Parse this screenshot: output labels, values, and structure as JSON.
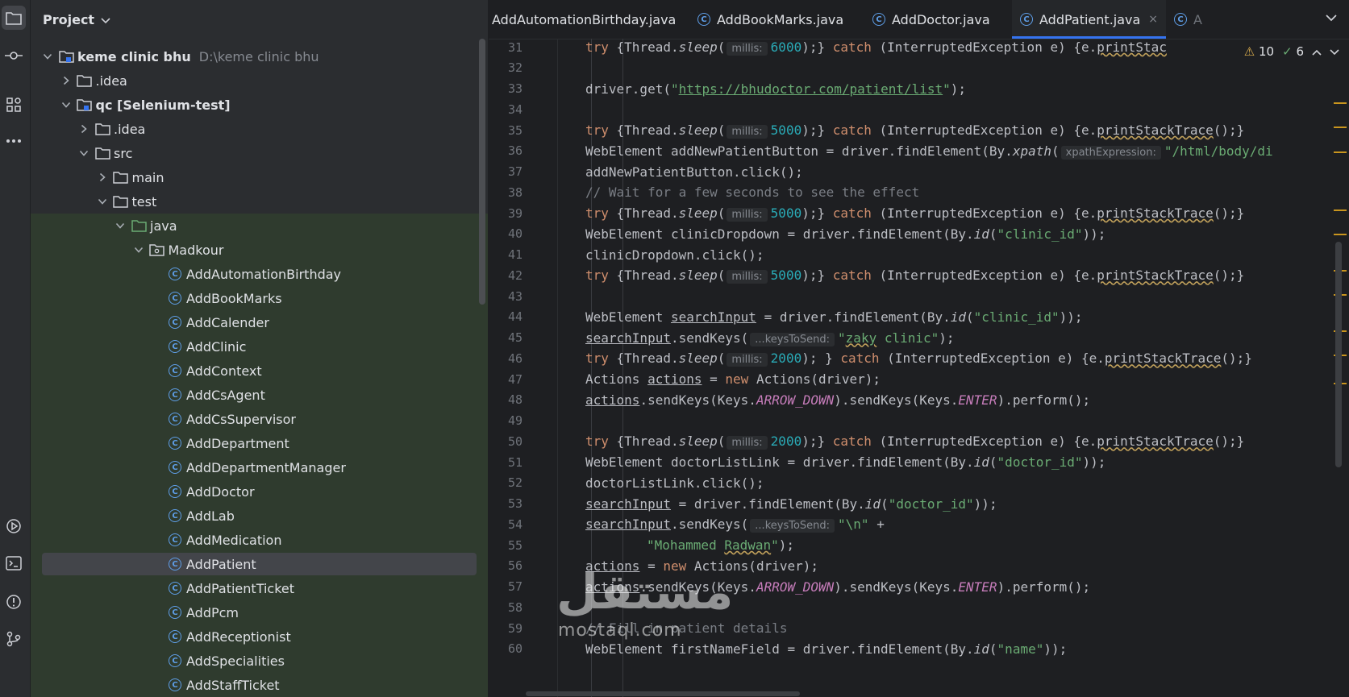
{
  "project_panel": {
    "title": "Project",
    "tree": [
      {
        "label": "keme clinic bhu",
        "path": "D:\\keme clinic bhu",
        "type": "module-folder",
        "depth": 0,
        "expanded": true
      },
      {
        "label": ".idea",
        "type": "folder",
        "depth": 1,
        "expanded": false
      },
      {
        "label": "qc [Selenium-test]",
        "type": "module-folder",
        "depth": 1,
        "expanded": true
      },
      {
        "label": ".idea",
        "type": "folder",
        "depth": 2,
        "expanded": false
      },
      {
        "label": "src",
        "type": "folder",
        "depth": 2,
        "expanded": true
      },
      {
        "label": "main",
        "type": "folder",
        "depth": 3,
        "expanded": false
      },
      {
        "label": "test",
        "type": "folder",
        "depth": 3,
        "expanded": true
      },
      {
        "label": "java",
        "type": "source-folder",
        "depth": 4,
        "expanded": true
      },
      {
        "label": "Madkour",
        "type": "package",
        "depth": 5,
        "expanded": true
      },
      {
        "label": "AddAutomationBirthday",
        "type": "class",
        "depth": 6
      },
      {
        "label": "AddBookMarks",
        "type": "class",
        "depth": 6
      },
      {
        "label": "AddCalender",
        "type": "class",
        "depth": 6
      },
      {
        "label": "AddClinic",
        "type": "class",
        "depth": 6
      },
      {
        "label": "AddContext",
        "type": "class",
        "depth": 6
      },
      {
        "label": "AddCsAgent",
        "type": "class",
        "depth": 6
      },
      {
        "label": "AddCsSupervisor",
        "type": "class",
        "depth": 6
      },
      {
        "label": "AddDepartment",
        "type": "class",
        "depth": 6
      },
      {
        "label": "AddDepartmentManager",
        "type": "class",
        "depth": 6
      },
      {
        "label": "AddDoctor",
        "type": "class",
        "depth": 6
      },
      {
        "label": "AddLab",
        "type": "class",
        "depth": 6
      },
      {
        "label": "AddMedication",
        "type": "class",
        "depth": 6
      },
      {
        "label": "AddPatient",
        "type": "class",
        "depth": 6,
        "selected": true
      },
      {
        "label": "AddPatientTicket",
        "type": "class",
        "depth": 6
      },
      {
        "label": "AddPcm",
        "type": "class",
        "depth": 6
      },
      {
        "label": "AddReceptionist",
        "type": "class",
        "depth": 6
      },
      {
        "label": "AddSpecialities",
        "type": "class",
        "depth": 6
      },
      {
        "label": "AddStaffTicket",
        "type": "class",
        "depth": 6
      }
    ]
  },
  "editor": {
    "tabs": [
      {
        "label": "AddAutomationBirthday.java",
        "active": false
      },
      {
        "label": "AddBookMarks.java",
        "active": false
      },
      {
        "label": "AddDoctor.java",
        "active": false
      },
      {
        "label": "AddPatient.java",
        "active": true
      },
      {
        "label": "A",
        "active": false
      }
    ],
    "tab_close": "×",
    "inspections": {
      "warnings": "10",
      "weak_warnings": "6"
    },
    "lines": [
      {
        "n": "31",
        "indent": 2,
        "tokens": [
          [
            "kw",
            "try "
          ],
          [
            "p",
            "{Thread."
          ],
          [
            "it",
            "sleep"
          ],
          [
            "p",
            "("
          ],
          [
            "hint",
            "millis:"
          ],
          [
            "num",
            "6000"
          ],
          [
            "p",
            ");} "
          ],
          [
            "kw",
            "catch "
          ],
          [
            "p",
            "(InterruptedException e) {e."
          ],
          [
            "wavy",
            "printStac"
          ]
        ]
      },
      {
        "n": "32",
        "indent": 0,
        "tokens": []
      },
      {
        "n": "33",
        "indent": 2,
        "tokens": [
          [
            "p",
            "driver.get("
          ],
          [
            "str",
            "\""
          ],
          [
            "url",
            "https://bhudoctor.com/patient/list"
          ],
          [
            "str",
            "\""
          ],
          [
            "p",
            ");"
          ]
        ]
      },
      {
        "n": "34",
        "indent": 0,
        "tokens": []
      },
      {
        "n": "35",
        "indent": 2,
        "tokens": [
          [
            "kw",
            "try "
          ],
          [
            "p",
            "{Thread."
          ],
          [
            "it",
            "sleep"
          ],
          [
            "p",
            "("
          ],
          [
            "hint",
            "millis:"
          ],
          [
            "num",
            "5000"
          ],
          [
            "p",
            ");} "
          ],
          [
            "kw",
            "catch "
          ],
          [
            "p",
            "(InterruptedException e) {e."
          ],
          [
            "wavy",
            "printStackTrace"
          ],
          [
            "p",
            "();}"
          ]
        ]
      },
      {
        "n": "36",
        "indent": 2,
        "tokens": [
          [
            "p",
            "WebElement addNewPatientButton = driver.findElement(By."
          ],
          [
            "it",
            "xpath"
          ],
          [
            "p",
            "("
          ],
          [
            "hint",
            "xpathExpression:"
          ],
          [
            "str",
            "\"/html/body/di"
          ]
        ]
      },
      {
        "n": "37",
        "indent": 2,
        "tokens": [
          [
            "p",
            "addNewPatientButton.click();"
          ]
        ]
      },
      {
        "n": "38",
        "indent": 2,
        "tokens": [
          [
            "cmt",
            "// Wait for a few seconds to see the effect"
          ]
        ]
      },
      {
        "n": "39",
        "indent": 2,
        "tokens": [
          [
            "kw",
            "try "
          ],
          [
            "p",
            "{Thread."
          ],
          [
            "it",
            "sleep"
          ],
          [
            "p",
            "("
          ],
          [
            "hint",
            "millis:"
          ],
          [
            "num",
            "5000"
          ],
          [
            "p",
            ");} "
          ],
          [
            "kw",
            "catch "
          ],
          [
            "p",
            "(InterruptedException e) {e."
          ],
          [
            "wavy",
            "printStackTrace"
          ],
          [
            "p",
            "();}"
          ]
        ]
      },
      {
        "n": "40",
        "indent": 2,
        "tokens": [
          [
            "p",
            "WebElement clinicDropdown = driver.findElement(By."
          ],
          [
            "it",
            "id"
          ],
          [
            "p",
            "("
          ],
          [
            "str",
            "\"clinic_id\""
          ],
          [
            "p",
            "));"
          ]
        ]
      },
      {
        "n": "41",
        "indent": 2,
        "tokens": [
          [
            "p",
            "clinicDropdown.click();"
          ]
        ]
      },
      {
        "n": "42",
        "indent": 2,
        "tokens": [
          [
            "kw",
            "try "
          ],
          [
            "p",
            "{Thread."
          ],
          [
            "it",
            "sleep"
          ],
          [
            "p",
            "("
          ],
          [
            "hint",
            "millis:"
          ],
          [
            "num",
            "5000"
          ],
          [
            "p",
            ");} "
          ],
          [
            "kw",
            "catch "
          ],
          [
            "p",
            "(InterruptedException e) {e."
          ],
          [
            "wavy",
            "printStackTrace"
          ],
          [
            "p",
            "();}"
          ]
        ]
      },
      {
        "n": "43",
        "indent": 0,
        "tokens": []
      },
      {
        "n": "44",
        "indent": 2,
        "tokens": [
          [
            "p",
            "WebElement "
          ],
          [
            "ul",
            "searchInput"
          ],
          [
            "p",
            " = driver.findElement(By."
          ],
          [
            "it",
            "id"
          ],
          [
            "p",
            "("
          ],
          [
            "str",
            "\"clinic_id\""
          ],
          [
            "p",
            "));"
          ]
        ]
      },
      {
        "n": "45",
        "indent": 2,
        "tokens": [
          [
            "ul",
            "searchInput"
          ],
          [
            "p",
            ".sendKeys("
          ],
          [
            "hint",
            "...keysToSend:"
          ],
          [
            "str",
            "\""
          ],
          [
            "strwavy",
            "zaky"
          ],
          [
            "str",
            " clinic\""
          ],
          [
            "p",
            ");"
          ]
        ]
      },
      {
        "n": "46",
        "indent": 2,
        "tokens": [
          [
            "kw",
            "try "
          ],
          [
            "p",
            "{Thread."
          ],
          [
            "it",
            "sleep"
          ],
          [
            "p",
            "("
          ],
          [
            "hint",
            "millis:"
          ],
          [
            "num",
            "2000"
          ],
          [
            "p",
            "); } "
          ],
          [
            "kw",
            "catch "
          ],
          [
            "p",
            "(InterruptedException e) {e."
          ],
          [
            "wavy",
            "printStackTrace"
          ],
          [
            "p",
            "();}"
          ]
        ]
      },
      {
        "n": "47",
        "indent": 2,
        "tokens": [
          [
            "p",
            "Actions "
          ],
          [
            "ul",
            "actions"
          ],
          [
            "p",
            " = "
          ],
          [
            "kw",
            "new "
          ],
          [
            "p",
            "Actions(driver);"
          ]
        ]
      },
      {
        "n": "48",
        "indent": 2,
        "tokens": [
          [
            "ul",
            "actions"
          ],
          [
            "p",
            ".sendKeys(Keys."
          ],
          [
            "field",
            "ARROW_DOWN"
          ],
          [
            "p",
            ").sendKeys(Keys."
          ],
          [
            "field",
            "ENTER"
          ],
          [
            "p",
            ").perform();"
          ]
        ]
      },
      {
        "n": "49",
        "indent": 0,
        "tokens": []
      },
      {
        "n": "50",
        "indent": 2,
        "tokens": [
          [
            "kw",
            "try "
          ],
          [
            "p",
            "{Thread."
          ],
          [
            "it",
            "sleep"
          ],
          [
            "p",
            "("
          ],
          [
            "hint",
            "millis:"
          ],
          [
            "num",
            "2000"
          ],
          [
            "p",
            ");} "
          ],
          [
            "kw",
            "catch "
          ],
          [
            "p",
            "(InterruptedException e) {e."
          ],
          [
            "wavy",
            "printStackTrace"
          ],
          [
            "p",
            "();}"
          ]
        ]
      },
      {
        "n": "51",
        "indent": 2,
        "tokens": [
          [
            "p",
            "WebElement doctorListLink = driver.findElement(By."
          ],
          [
            "it",
            "id"
          ],
          [
            "p",
            "("
          ],
          [
            "str",
            "\"doctor_id\""
          ],
          [
            "p",
            "));"
          ]
        ]
      },
      {
        "n": "52",
        "indent": 2,
        "tokens": [
          [
            "p",
            "doctorListLink.click();"
          ]
        ]
      },
      {
        "n": "53",
        "indent": 2,
        "tokens": [
          [
            "ul",
            "searchInput"
          ],
          [
            "p",
            " = driver.findElement(By."
          ],
          [
            "it",
            "id"
          ],
          [
            "p",
            "("
          ],
          [
            "str",
            "\"doctor_id\""
          ],
          [
            "p",
            "));"
          ]
        ]
      },
      {
        "n": "54",
        "indent": 2,
        "tokens": [
          [
            "ul",
            "searchInput"
          ],
          [
            "p",
            ".sendKeys("
          ],
          [
            "hint",
            "...keysToSend:"
          ],
          [
            "str",
            "\"\\n\""
          ],
          [
            "p",
            " +"
          ]
        ]
      },
      {
        "n": "55",
        "indent": 3,
        "tokens": [
          [
            "str",
            "\"Mohammed "
          ],
          [
            "strwavy",
            "Radwan"
          ],
          [
            "str",
            "\""
          ],
          [
            "p",
            ");"
          ]
        ]
      },
      {
        "n": "56",
        "indent": 2,
        "tokens": [
          [
            "ul",
            "actions"
          ],
          [
            "p",
            " = "
          ],
          [
            "kw",
            "new "
          ],
          [
            "p",
            "Actions(driver);"
          ]
        ]
      },
      {
        "n": "57",
        "indent": 2,
        "tokens": [
          [
            "ul",
            "actions"
          ],
          [
            "p",
            ".sendKeys(Keys."
          ],
          [
            "field",
            "ARROW_DOWN"
          ],
          [
            "p",
            ").sendKeys(Keys."
          ],
          [
            "field",
            "ENTER"
          ],
          [
            "p",
            ").perform();"
          ]
        ]
      },
      {
        "n": "58",
        "indent": 0,
        "tokens": []
      },
      {
        "n": "59",
        "indent": 2,
        "tokens": [
          [
            "cmt",
            "// Fill in patient details"
          ]
        ]
      },
      {
        "n": "60",
        "indent": 2,
        "tokens": [
          [
            "p",
            "WebElement firstNameField = driver.findElement(By."
          ],
          [
            "it",
            "id"
          ],
          [
            "p",
            "("
          ],
          [
            "str",
            "\"name\""
          ],
          [
            "p",
            "));"
          ]
        ]
      }
    ]
  },
  "watermark": {
    "arabic": "مستقل",
    "latin": "mostaql.com"
  }
}
